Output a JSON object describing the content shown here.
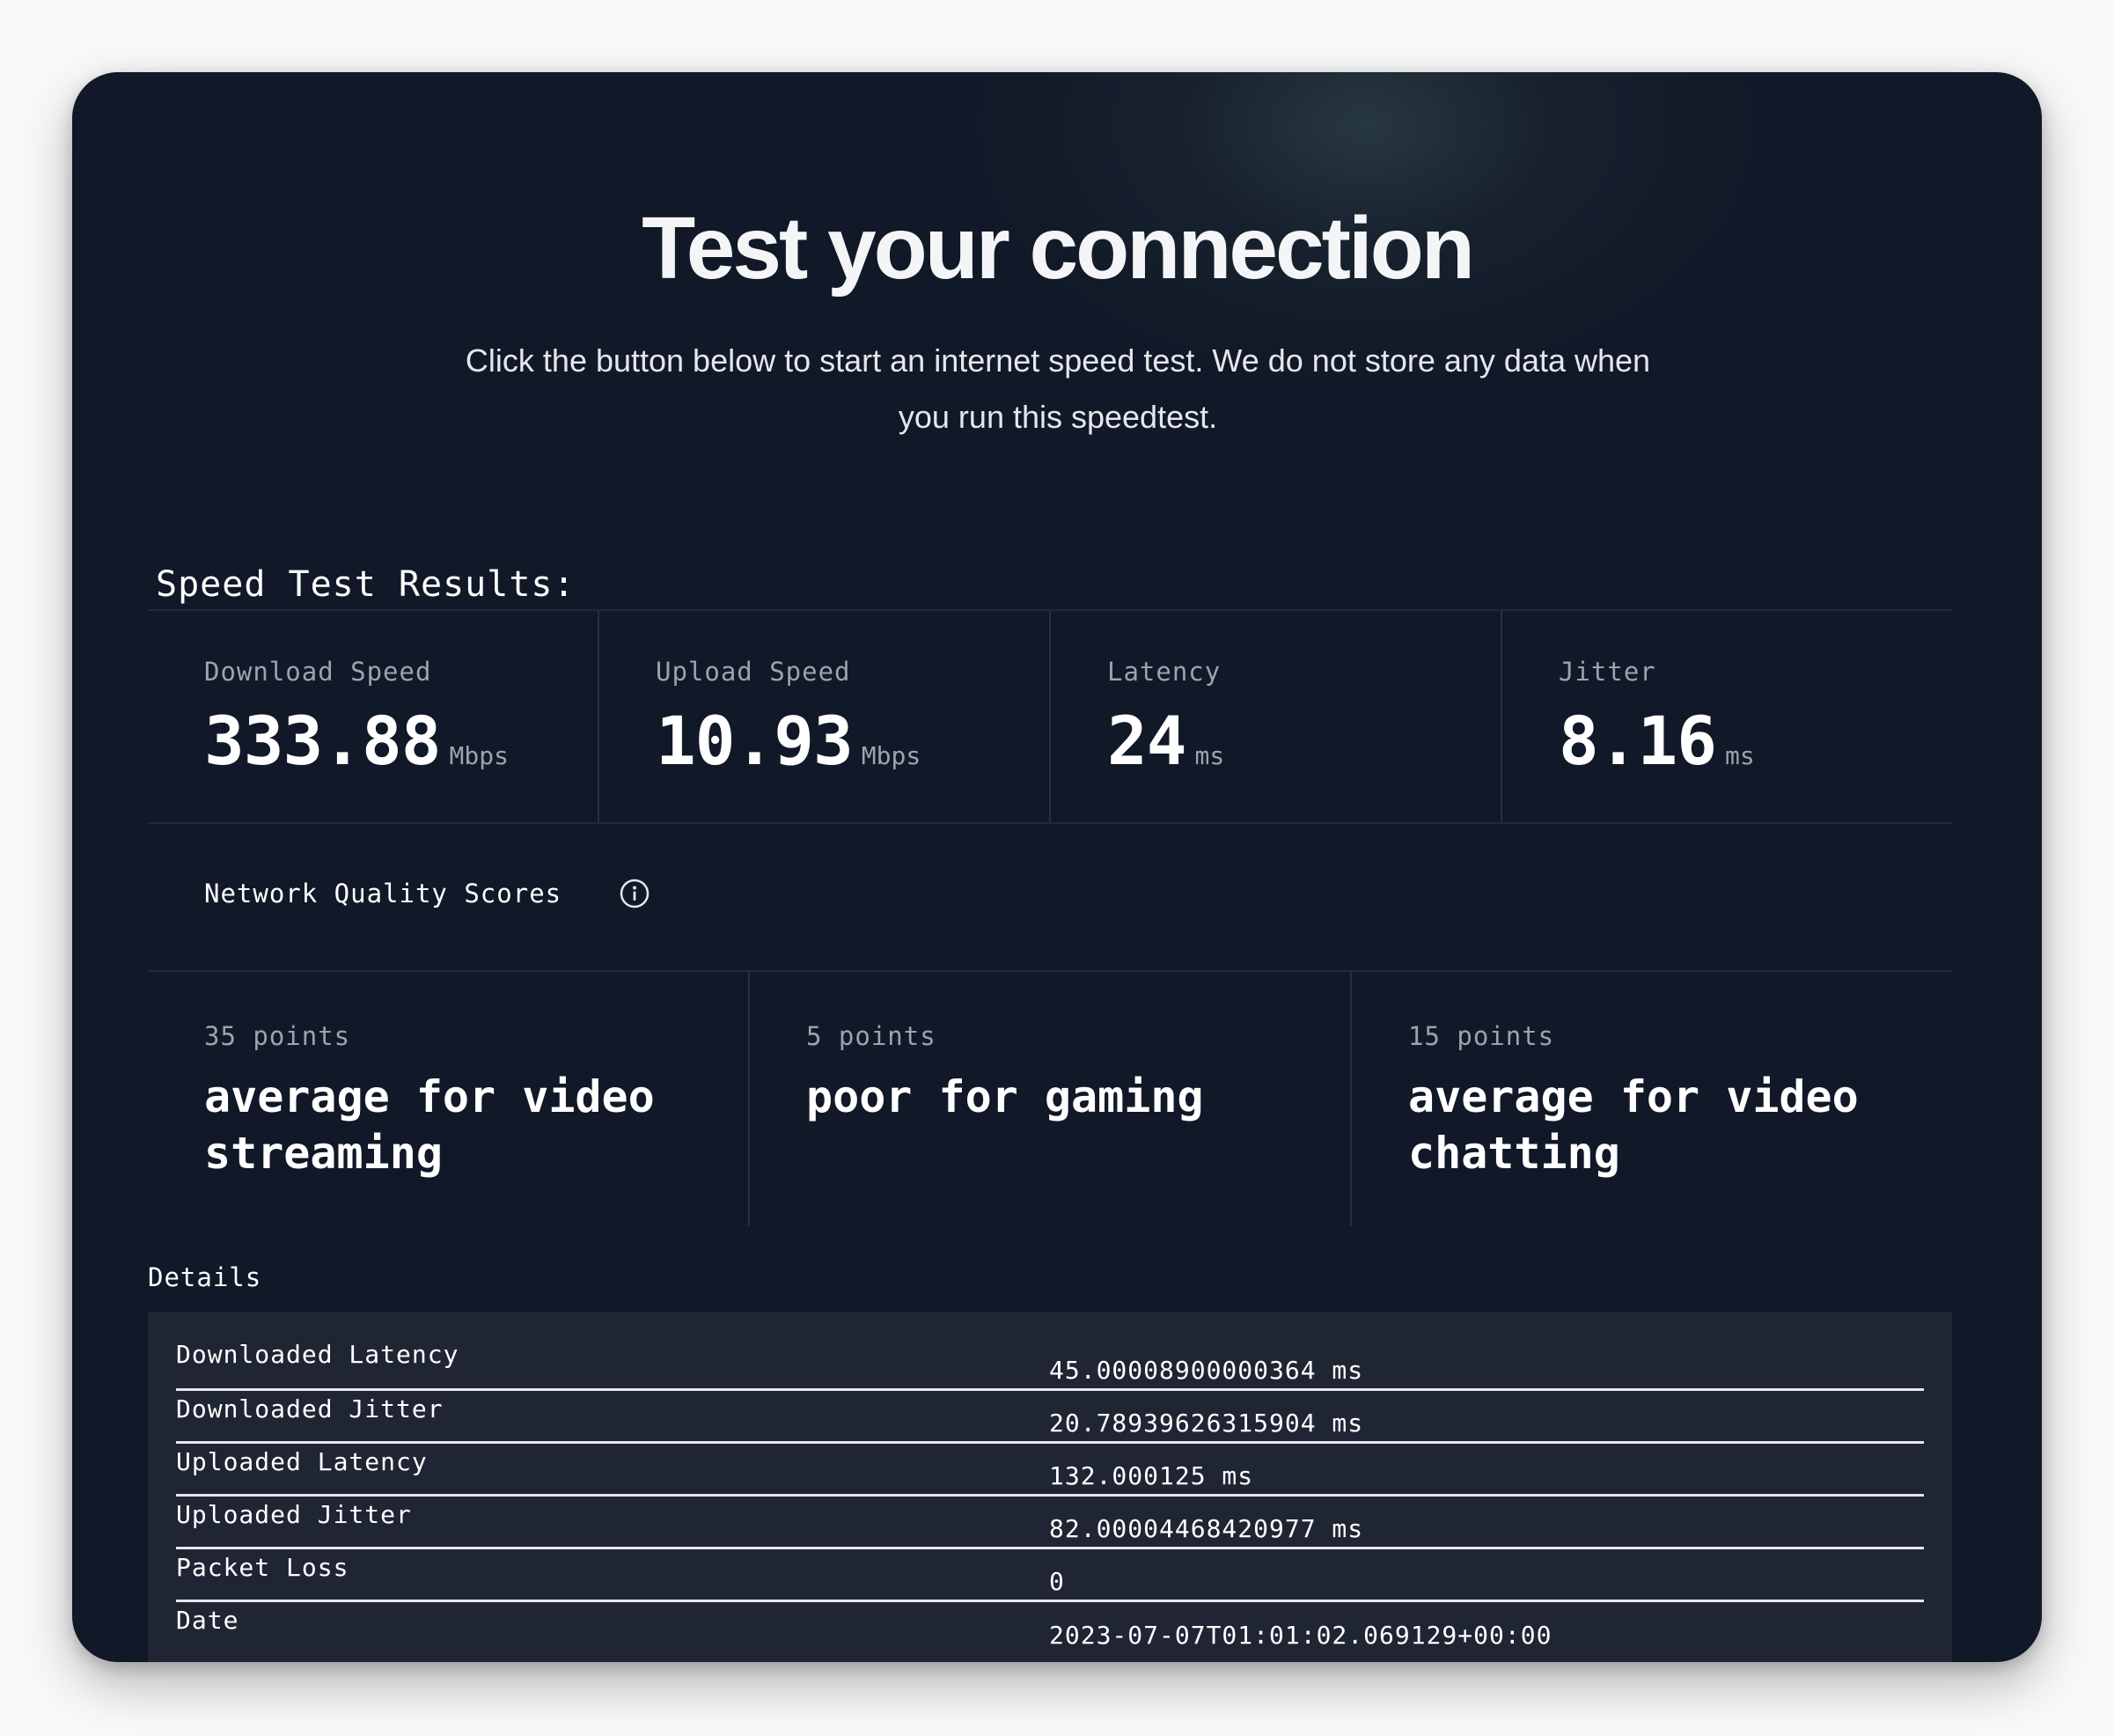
{
  "header": {
    "title": "Test your connection",
    "subtitle": "Click the button below to start an internet speed test. We do not store any data when you run this speedtest."
  },
  "results": {
    "heading": "Speed Test Results:",
    "metrics": [
      {
        "label": "Download Speed",
        "value": "333.88",
        "unit": "Mbps"
      },
      {
        "label": "Upload Speed",
        "value": "10.93",
        "unit": "Mbps"
      },
      {
        "label": "Latency",
        "value": "24",
        "unit": "ms"
      },
      {
        "label": "Jitter",
        "value": "8.16",
        "unit": "ms"
      }
    ]
  },
  "quality": {
    "label": "Network Quality Scores",
    "info_icon": "info-circle-icon",
    "scores": [
      {
        "points": "35 points",
        "description": "average for video streaming"
      },
      {
        "points": "5 points",
        "description": "poor for gaming"
      },
      {
        "points": "15 points",
        "description": "average for video chatting"
      }
    ]
  },
  "details": {
    "label": "Details",
    "rows": [
      {
        "key": "Downloaded Latency",
        "value": "45.00008900000364 ms"
      },
      {
        "key": "Downloaded Jitter",
        "value": "20.78939626315904 ms"
      },
      {
        "key": "Uploaded Latency",
        "value": "132.000125 ms"
      },
      {
        "key": "Uploaded Jitter",
        "value": "82.00004468420977 ms"
      },
      {
        "key": "Packet Loss",
        "value": "0"
      },
      {
        "key": "Date",
        "value": "2023-07-07T01:01:02.069129+00:00"
      }
    ]
  },
  "colors": {
    "page_background": "#f9f9fa",
    "card_background": "#111827",
    "details_background": "#1f2533",
    "muted_text": "#9ca3af",
    "text": "#ffffff"
  }
}
